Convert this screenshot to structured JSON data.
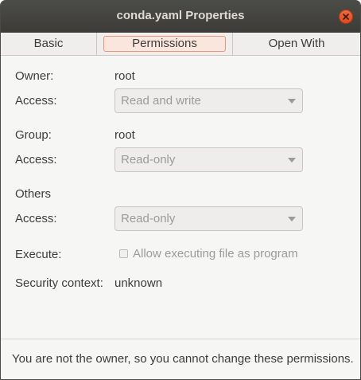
{
  "window": {
    "title": "conda.yaml Properties"
  },
  "tabs": [
    {
      "label": "Basic",
      "active": false
    },
    {
      "label": "Permissions",
      "active": true
    },
    {
      "label": "Open With",
      "active": false
    }
  ],
  "permissions": {
    "owner": {
      "label": "Owner:",
      "value": "root"
    },
    "owner_access": {
      "label": "Access:",
      "value": "Read and write"
    },
    "group": {
      "label": "Group:",
      "value": "root"
    },
    "group_access": {
      "label": "Access:",
      "value": "Read-only"
    },
    "others": {
      "label": "Others"
    },
    "others_access": {
      "label": "Access:",
      "value": "Read-only"
    },
    "execute": {
      "label": "Execute:",
      "checkbox_label": "Allow executing file as program",
      "checked": false
    },
    "security_context": {
      "label": "Security context:",
      "value": "unknown"
    }
  },
  "footer": {
    "note": "You are not the owner, so you cannot change these permissions."
  },
  "colors": {
    "titlebar": "#3c3b37",
    "close_button": "#df4a16",
    "active_tab_border": "#e6957a",
    "disabled_text": "#9b9b9b"
  }
}
